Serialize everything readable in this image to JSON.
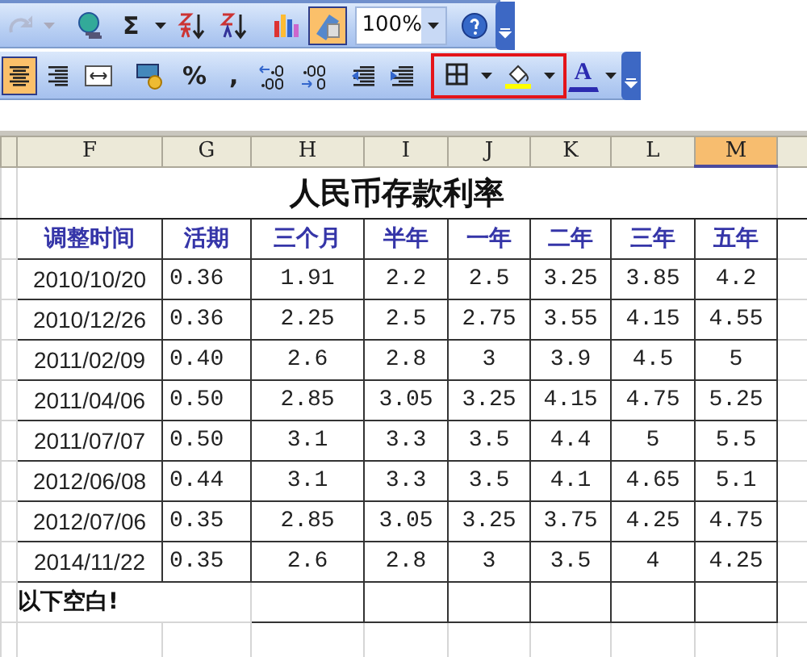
{
  "toolbar_standard": {
    "sum_label": "Σ",
    "zoom": "100%",
    "drawing_pressed": true
  },
  "toolbar_formatting": {
    "center_pressed": true,
    "percent_label": "%",
    "comma_label": ",",
    "font_color_label": "A",
    "highlight_box": true
  },
  "columns": [
    {
      "label": "F",
      "selected": false
    },
    {
      "label": "G",
      "selected": false
    },
    {
      "label": "H",
      "selected": false
    },
    {
      "label": "I",
      "selected": false
    },
    {
      "label": "J",
      "selected": false
    },
    {
      "label": "K",
      "selected": false
    },
    {
      "label": "L",
      "selected": false
    },
    {
      "label": "M",
      "selected": true
    }
  ],
  "title": "人民币存款利率",
  "headers": [
    "调整时间",
    "活期",
    "三个月",
    "半年",
    "一年",
    "二年",
    "三年",
    "五年"
  ],
  "rows": [
    [
      "2010/10/20",
      "0.36",
      "1.91",
      "2.2",
      "2.5",
      "3.25",
      "3.85",
      "4.2"
    ],
    [
      "2010/12/26",
      "0.36",
      "2.25",
      "2.5",
      "2.75",
      "3.55",
      "4.15",
      "4.55"
    ],
    [
      "2011/02/09",
      "0.40",
      "2.6",
      "2.8",
      "3",
      "3.9",
      "4.5",
      "5"
    ],
    [
      "2011/04/06",
      "0.50",
      "2.85",
      "3.05",
      "3.25",
      "4.15",
      "4.75",
      "5.25"
    ],
    [
      "2011/07/07",
      "0.50",
      "3.1",
      "3.3",
      "3.5",
      "4.4",
      "5",
      "5.5"
    ],
    [
      "2012/06/08",
      "0.44",
      "3.1",
      "3.3",
      "3.5",
      "4.1",
      "4.65",
      "5.1"
    ],
    [
      "2012/07/06",
      "0.35",
      "2.85",
      "3.05",
      "3.25",
      "3.75",
      "4.25",
      "4.75"
    ],
    [
      "2014/11/22",
      "0.35",
      "2.6",
      "2.8",
      "3",
      "3.5",
      "4",
      "4.25"
    ]
  ],
  "footer_note": "以下空白!"
}
